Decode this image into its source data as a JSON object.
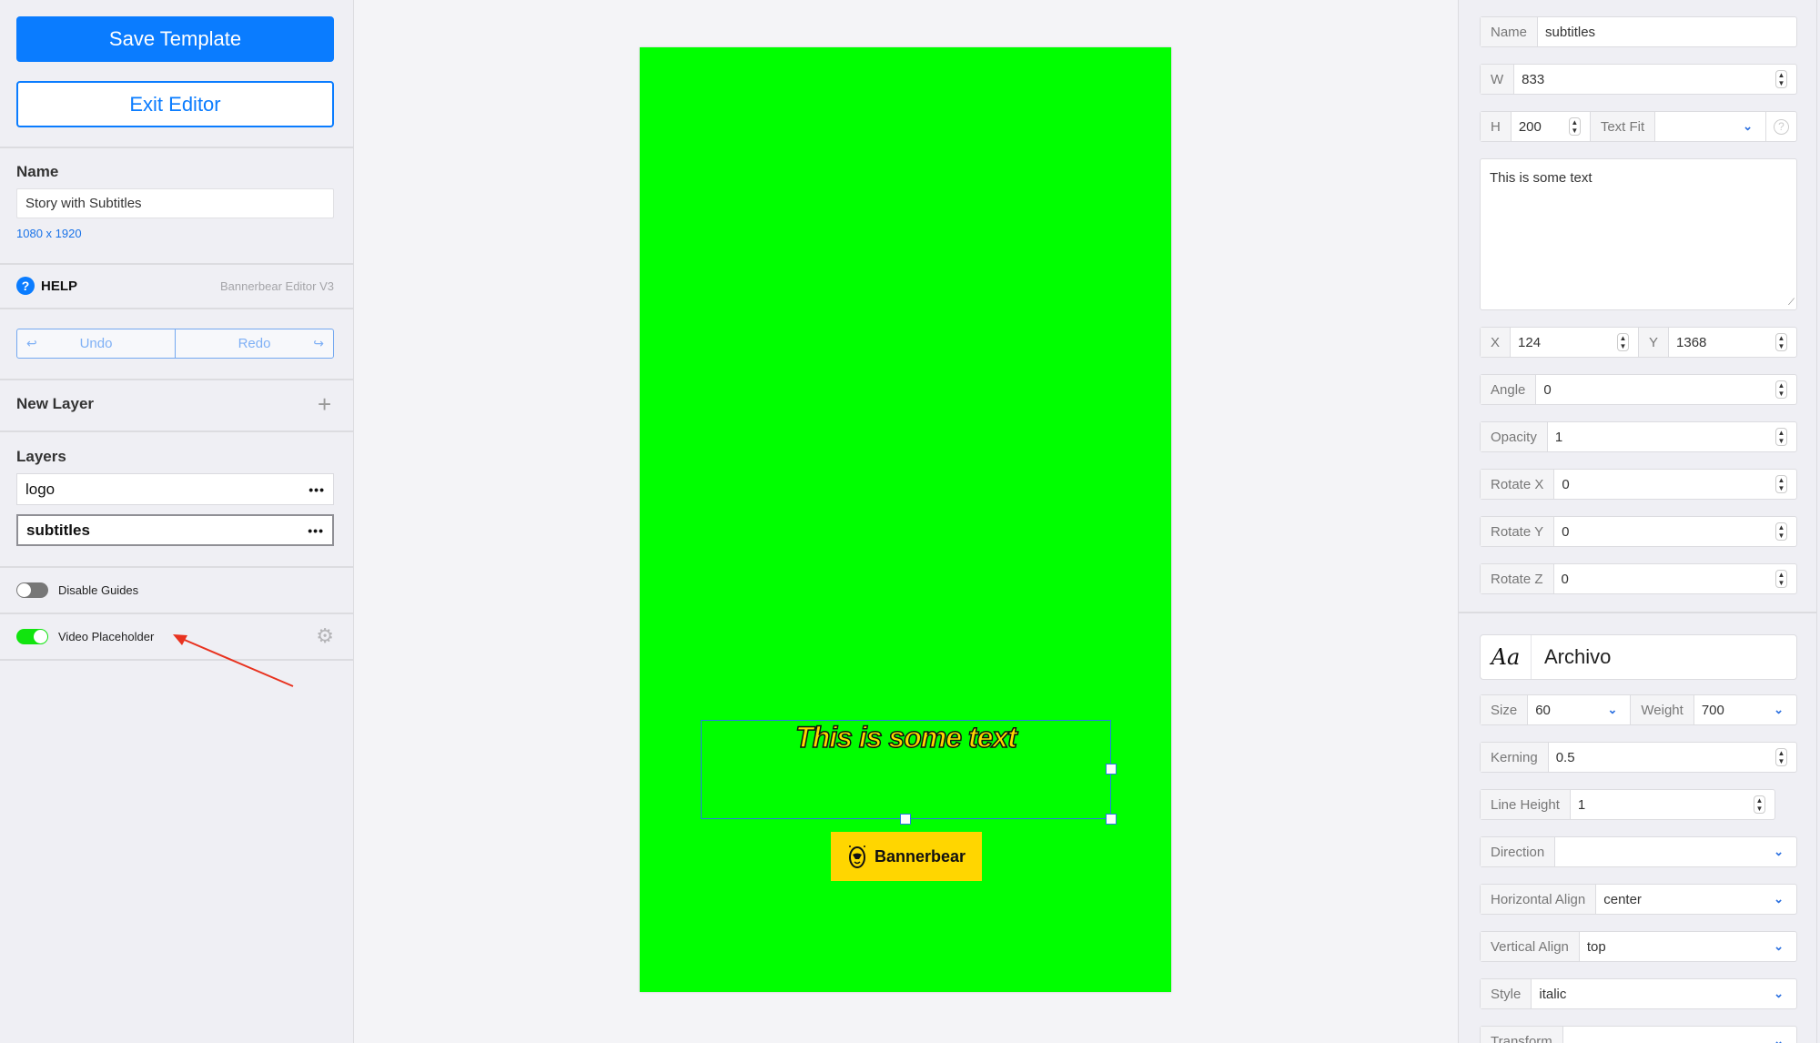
{
  "left_panel": {
    "save_button": "Save Template",
    "exit_button": "Exit Editor",
    "name_label": "Name",
    "name_value": "Story with Subtitles",
    "dimensions": "1080 x 1920",
    "help_icon": "?",
    "help_label": "HELP",
    "editor_version": "Bannerbear Editor V3",
    "undo_label": "Undo",
    "redo_label": "Redo",
    "undo_icon": "↩",
    "redo_icon": "↪",
    "new_layer_label": "New Layer",
    "add_icon": "+",
    "layers_label": "Layers",
    "layers": [
      {
        "name": "logo",
        "selected": false,
        "menu": "•••"
      },
      {
        "name": "subtitles",
        "selected": true,
        "menu": "•••"
      }
    ],
    "disable_guides": {
      "label": "Disable Guides",
      "on": false
    },
    "video_placeholder": {
      "label": "Video Placeholder",
      "on": true,
      "settings_icon": "⚙"
    }
  },
  "canvas": {
    "background": "#00ff00",
    "text_layer": "This is some text",
    "text_color": "#ffd600",
    "logo_text": "Bannerbear",
    "logo_bg": "#ffd600"
  },
  "right_panel": {
    "name": {
      "label": "Name",
      "value": "subtitles"
    },
    "width": {
      "label": "W",
      "value": "833"
    },
    "height": {
      "label": "H",
      "value": "200"
    },
    "text_fit": {
      "label": "Text Fit",
      "value": ""
    },
    "text_fit_help": "?",
    "text_content": "This is some text",
    "x": {
      "label": "X",
      "value": "124"
    },
    "y": {
      "label": "Y",
      "value": "1368"
    },
    "angle": {
      "label": "Angle",
      "value": "0"
    },
    "opacity": {
      "label": "Opacity",
      "value": "1"
    },
    "rotate_x": {
      "label": "Rotate X",
      "value": "0"
    },
    "rotate_y": {
      "label": "Rotate Y",
      "value": "0"
    },
    "rotate_z": {
      "label": "Rotate Z",
      "value": "0"
    },
    "font_icon": "Aa",
    "font_name": "Archivo",
    "size": {
      "label": "Size",
      "value": "60"
    },
    "weight": {
      "label": "Weight",
      "value": "700"
    },
    "kerning": {
      "label": "Kerning",
      "value": "0.5"
    },
    "line_height": {
      "label": "Line Height",
      "value": "1"
    },
    "direction": {
      "label": "Direction",
      "value": ""
    },
    "horizontal_align": {
      "label": "Horizontal Align",
      "value": "center"
    },
    "vertical_align": {
      "label": "Vertical Align",
      "value": "top"
    },
    "style": {
      "label": "Style",
      "value": "italic"
    },
    "transform": {
      "label": "Transform",
      "value": ""
    },
    "spinner_icon": "⌃⌄",
    "chevron_icon": "❯"
  },
  "colors": {
    "accent": "#0a7cff",
    "toggle_on": "#11e40f",
    "annotation_arrow": "#e8321f"
  }
}
